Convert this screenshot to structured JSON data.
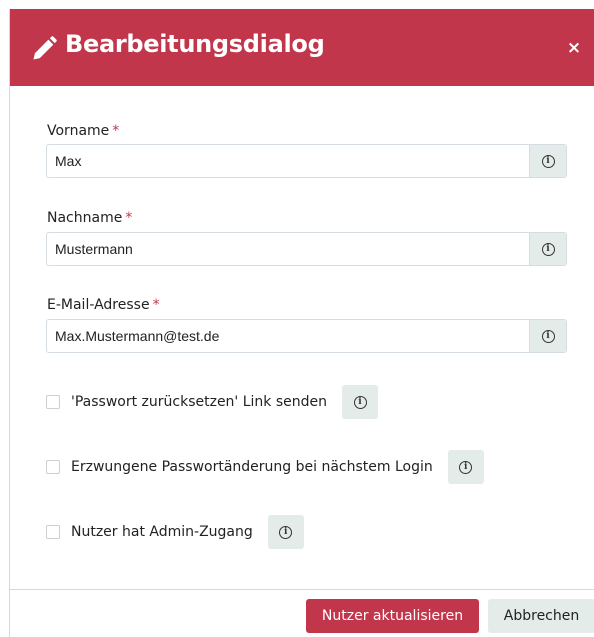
{
  "dialog": {
    "title": "Bearbeitungsdialog",
    "close_label": "×",
    "accent_color": "#c1364b",
    "addon_color": "#e3ece9"
  },
  "fields": [
    {
      "label": "Vorname",
      "required_mark": "*",
      "value": "Max",
      "info_icon": "info-icon"
    },
    {
      "label": "Nachname",
      "required_mark": "*",
      "value": "Mustermann",
      "info_icon": "info-icon"
    },
    {
      "label": "E-Mail-Adresse",
      "required_mark": "*",
      "value": "Max.Mustermann@test.de",
      "info_icon": "info-icon"
    }
  ],
  "checkboxes": [
    {
      "label": "'Passwort zurücksetzen' Link senden",
      "checked": false
    },
    {
      "label": "Erzwungene Passwortänderung bei nächstem Login",
      "checked": false
    },
    {
      "label": "Nutzer hat Admin-Zugang",
      "checked": false
    }
  ],
  "footer": {
    "update_label": "Nutzer aktualisieren",
    "cancel_label": "Abbrechen"
  },
  "icons": {
    "info_glyph": "i"
  }
}
